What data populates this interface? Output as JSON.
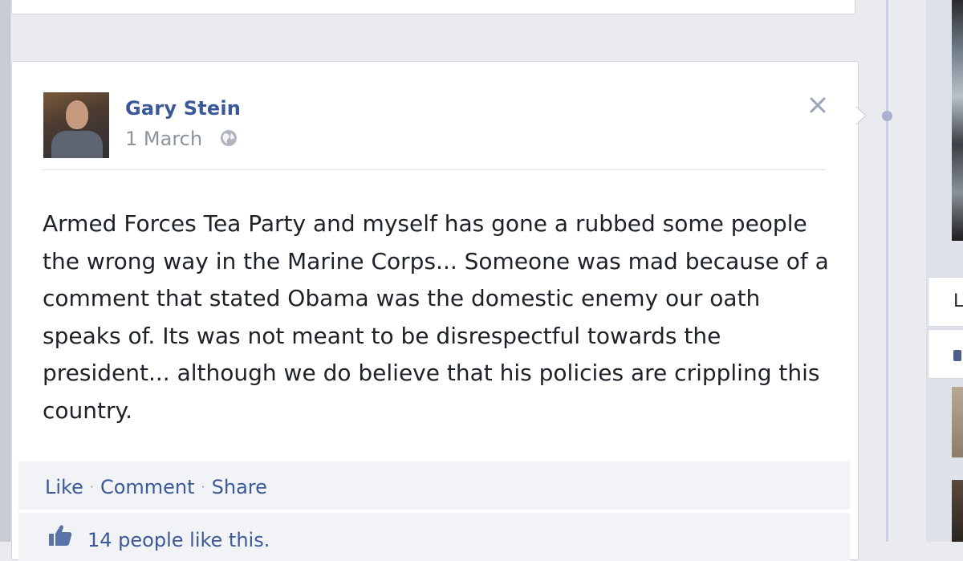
{
  "post": {
    "author": "Gary Stein",
    "date": "1 March",
    "privacy_icon": "globe-icon",
    "text": "Armed Forces Tea Party and myself has gone a rubbed some people the wrong way in the Marine Corps... Someone was mad because of a comment that stated Obama was the domestic enemy our oath speaks of. Its was not meant to be disrespectful towards the president... although we do believe that his policies are crippling this country.",
    "actions": {
      "like": "Like",
      "comment": "Comment",
      "share": "Share",
      "separator": "·"
    },
    "likes_text": "14 people like this."
  },
  "right_column": {
    "box_label": "L"
  },
  "colors": {
    "link": "#3b5998",
    "text": "#1d2129",
    "muted": "#8d949e",
    "background": "#e9ebee"
  }
}
